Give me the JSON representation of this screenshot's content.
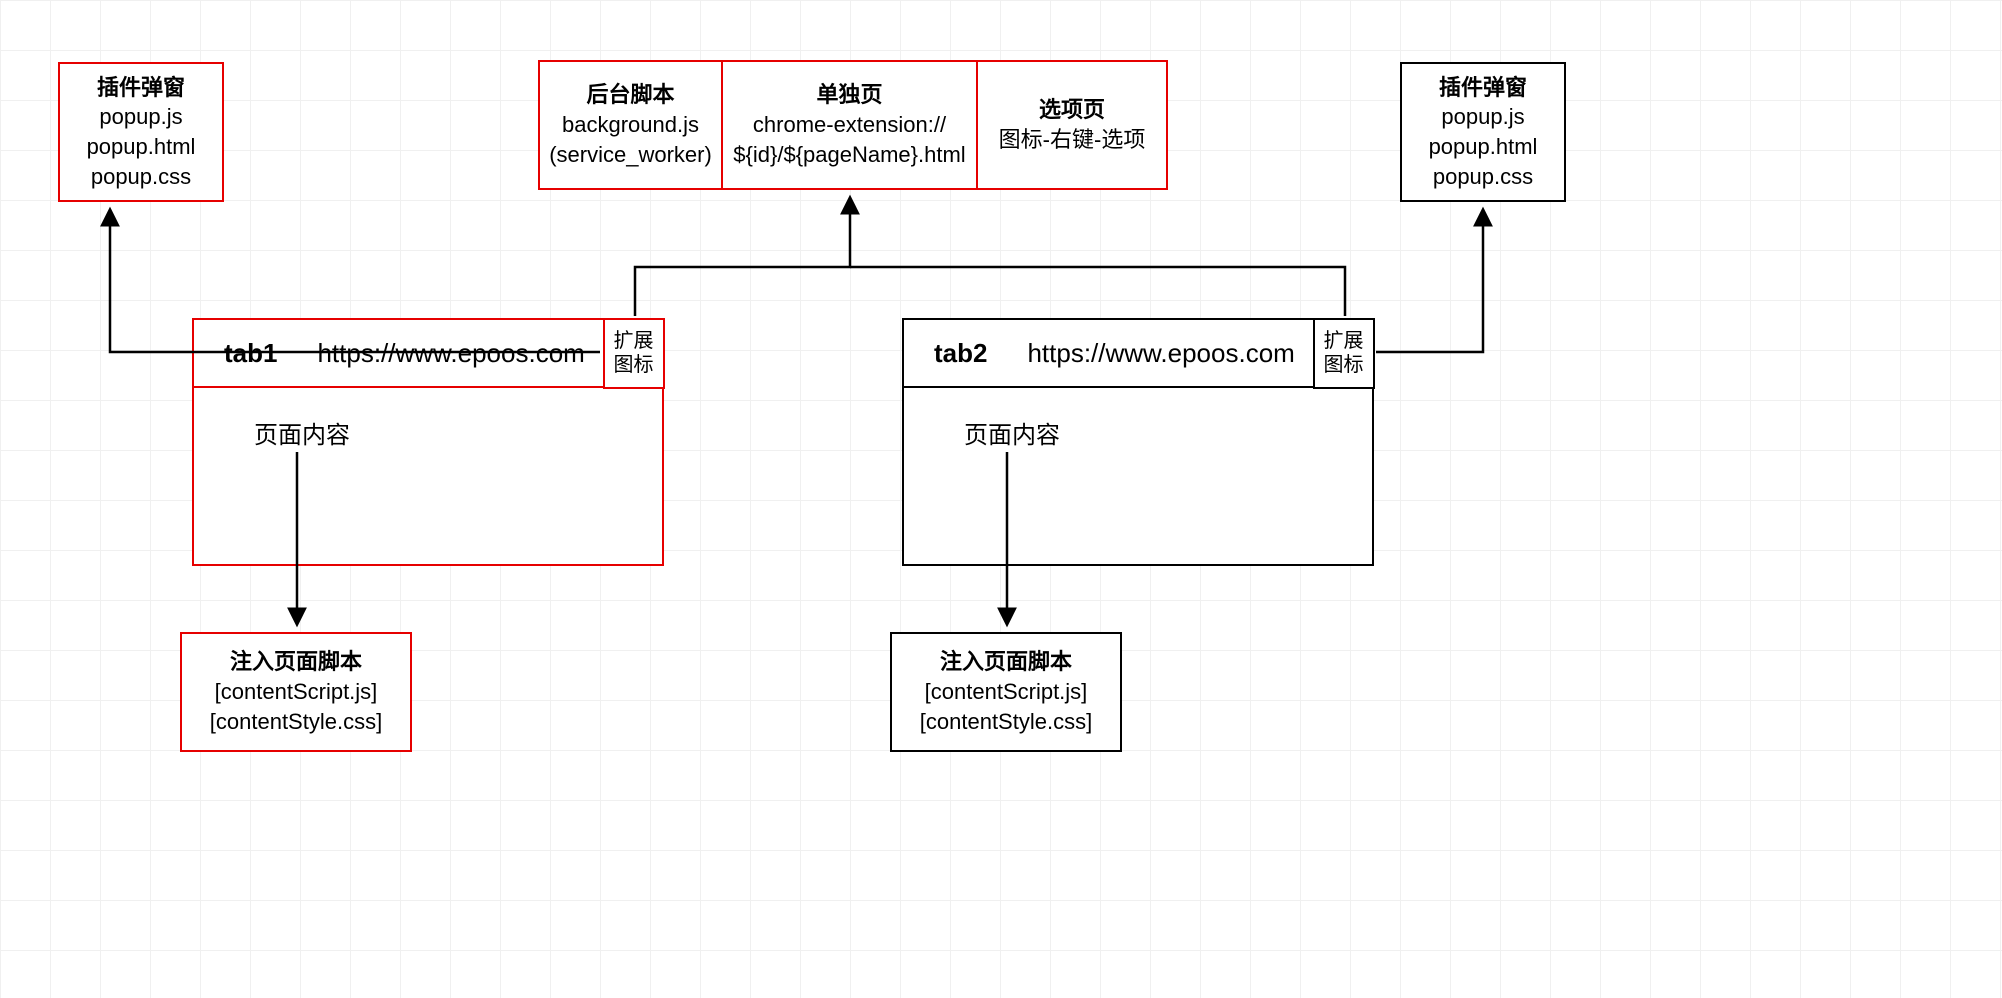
{
  "popup_left": {
    "title": "插件弹窗",
    "lines": [
      "popup.js",
      "popup.html",
      "popup.css"
    ]
  },
  "popup_right": {
    "title": "插件弹窗",
    "lines": [
      "popup.js",
      "popup.html",
      "popup.css"
    ]
  },
  "top_group": {
    "bg": {
      "title": "后台脚本",
      "lines": [
        "background.js",
        "(service_worker)"
      ]
    },
    "page": {
      "title": "单独页",
      "lines": [
        "chrome-extension://",
        "${id}/${pageName}.html"
      ]
    },
    "options": {
      "title": "选项页",
      "lines": [
        "图标-右键-选项"
      ]
    }
  },
  "tab1": {
    "name": "tab1",
    "url": "https://www.epoos.com",
    "ext_icon_l1": "扩展",
    "ext_icon_l2": "图标",
    "page_label": "页面内容"
  },
  "tab2": {
    "name": "tab2",
    "url": "https://www.epoos.com",
    "ext_icon_l1": "扩展",
    "ext_icon_l2": "图标",
    "page_label": "页面内容"
  },
  "inject_left": {
    "title": "注入页面脚本",
    "lines": [
      "[contentScript.js]",
      "[contentStyle.css]"
    ]
  },
  "inject_right": {
    "title": "注入页面脚本",
    "lines": [
      "[contentScript.js]",
      "[contentStyle.css]"
    ]
  }
}
